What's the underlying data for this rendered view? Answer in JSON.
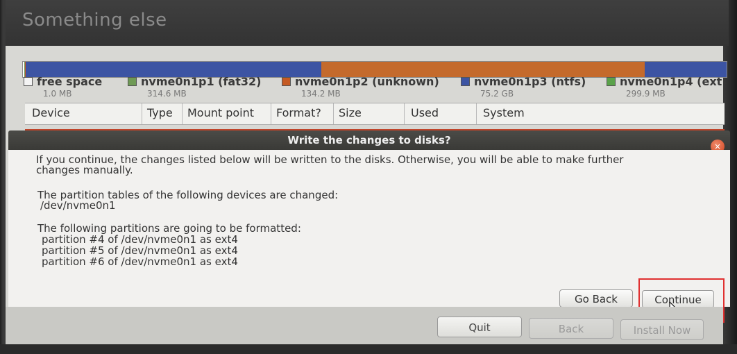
{
  "window": {
    "title": "Something else"
  },
  "partition_bar": {
    "segments": [
      {
        "name": "free space",
        "color": "#ffffff",
        "frac": 0.002
      },
      {
        "name": "nvme0n1p1",
        "color": "#6f9a55",
        "frac": 0.001
      },
      {
        "name": "nvme0n1p2",
        "color": "#c55a22",
        "frac": 0.001
      },
      {
        "name": "nvme0n1p3",
        "color": "#3c54a3",
        "frac": 0.42
      },
      {
        "name": "nvme0n1p2",
        "color": "#c46a2c",
        "frac": 0.46
      },
      {
        "name": "nvme0n1p4",
        "color": "#3c54a3",
        "frac": 0.116
      }
    ]
  },
  "legend": [
    {
      "name": "free space",
      "size": "1.0 MB",
      "color": "#f4f4f4"
    },
    {
      "name": "nvme0n1p1 (fat32)",
      "size": "314.6 MB",
      "color": "#6f9a55"
    },
    {
      "name": "nvme0n1p2 (unknown)",
      "size": "134.2 MB",
      "color": "#c55a22"
    },
    {
      "name": "nvme0n1p3 (ntfs)",
      "size": "75.2 GB",
      "color": "#3c54a3"
    },
    {
      "name": "nvme0n1p4 (ext",
      "size": "299.9 MB",
      "color": "#5aa24a"
    }
  ],
  "table": {
    "columns": [
      "Device",
      "Type",
      "Mount point",
      "Format?",
      "Size",
      "Used",
      "System"
    ]
  },
  "dialog": {
    "title": "Write the changes to disks?",
    "intro_line1": "If you continue, the changes listed below will be written to the disks. Otherwise, you will be able to make further",
    "intro_line2": "changes manually.",
    "tables_heading": "The partition tables of the following devices are changed:",
    "tables_device": "/dev/nvme0n1",
    "format_heading": "The following partitions are going to be formatted:",
    "format_items": [
      "partition #4 of /dev/nvme0n1 as ext4",
      "partition #5 of /dev/nvme0n1 as ext4",
      "partition #6 of /dev/nvme0n1 as ext4"
    ],
    "go_back_label": "Go Back",
    "continue_label": "Continue",
    "close_symbol": "×"
  },
  "nav": {
    "quit_label": "Quit",
    "back_label": "Back",
    "install_label": "Install Now"
  }
}
